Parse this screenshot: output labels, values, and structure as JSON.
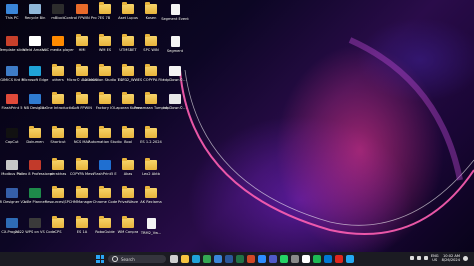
{
  "desktop": {
    "icons": [
      {
        "label": "This PC",
        "kind": "app",
        "color": "#3a86d9"
      },
      {
        "label": "Recycle Bin",
        "kind": "app",
        "color": "#8fb7d9"
      },
      {
        "label": "mBlock",
        "kind": "app",
        "color": "#2c2c2c"
      },
      {
        "label": "Control FPWIN Pro 7",
        "kind": "app",
        "color": "#e86a2a"
      },
      {
        "label": "ES 7B",
        "kind": "folder"
      },
      {
        "label": "Aset Lupus",
        "kind": "folder"
      },
      {
        "label": "Kosen",
        "kind": "folder"
      },
      {
        "label": "Segment Event",
        "kind": "file"
      },
      {
        "label": "Template slide",
        "kind": "app",
        "color": "#c7402b"
      },
      {
        "label": "Weld Amakei",
        "kind": "app",
        "color": "#ffffff"
      },
      {
        "label": "VLC media player",
        "kind": "app",
        "color": "#ff8a00"
      },
      {
        "label": "HMI",
        "kind": "folder"
      },
      {
        "label": "WM ES",
        "kind": "folder"
      },
      {
        "label": "UTMSBET",
        "kind": "folder"
      },
      {
        "label": "SPC WIN",
        "kind": "folder"
      },
      {
        "label": "Segment",
        "kind": "file"
      },
      {
        "label": "GIMICS Krd B",
        "kind": "app",
        "color": "#3e7cc7"
      },
      {
        "label": "Microsoft Edge",
        "kind": "app",
        "color": "#1fa3d8"
      },
      {
        "label": "others",
        "kind": "folder"
      },
      {
        "label": "Micro© A 2.2023",
        "kind": "folder"
      },
      {
        "label": "Automation Studio 7.0 ...",
        "kind": "folder"
      },
      {
        "label": "ESP32_WW",
        "kind": "folder"
      },
      {
        "label": "ES COPYPA File",
        "kind": "folder"
      },
      {
        "label": "tdpDown©...",
        "kind": "app",
        "color": "#f4f4f4"
      },
      {
        "label": "FlashPrint 5",
        "kind": "app",
        "color": "#e04a3a"
      },
      {
        "label": "NB Designer",
        "kind": "app",
        "color": "#2f7bd0"
      },
      {
        "label": "CX-One Introductio...",
        "kind": "folder"
      },
      {
        "label": "Soft FPWIN",
        "kind": "folder"
      },
      {
        "label": "Factory IO",
        "kind": "folder"
      },
      {
        "label": "Laporan Kuines",
        "kind": "folder"
      },
      {
        "label": "Penamaan Tumpak",
        "kind": "folder"
      },
      {
        "label": "tdpDown©...",
        "kind": "app",
        "color": "#e8e8e8"
      },
      {
        "label": "CapCut",
        "kind": "app",
        "color": "#111111"
      },
      {
        "label": "Dokumen",
        "kind": "folder"
      },
      {
        "label": "Shortcut",
        "kind": "folder"
      },
      {
        "label": "NCS MAP",
        "kind": "folder"
      },
      {
        "label": "Automation Studio",
        "kind": "folder"
      },
      {
        "label": "Bool",
        "kind": "folder"
      },
      {
        "label": "ES 1.2.2024",
        "kind": "folder"
      },
      {
        "label": "Modbus Poll",
        "kind": "app",
        "color": "#c7c7c7"
      },
      {
        "label": "Pixlex 8 Professional",
        "kind": "app",
        "color": "#c23a2a"
      },
      {
        "label": "perakhas",
        "kind": "folder"
      },
      {
        "label": "COPYPA Mess",
        "kind": "folder"
      },
      {
        "label": "FlashPrint5 E",
        "kind": "app",
        "color": "#1f6fd1"
      },
      {
        "label": "Akas",
        "kind": "folder"
      },
      {
        "label": "Lex2 Aktb",
        "kind": "folder"
      },
      {
        "label": "HMI Designer V2.7",
        "kind": "app",
        "color": "#355ea8"
      },
      {
        "label": "avie Planner",
        "kind": "app",
        "color": "#1e8a4a"
      },
      {
        "label": "Resources\\SPC",
        "kind": "folder"
      },
      {
        "label": "HMManager",
        "kind": "folder"
      },
      {
        "label": "Chrome Code",
        "kind": "folder"
      },
      {
        "label": "PrivatWave",
        "kind": "folder"
      },
      {
        "label": "AK Reclama",
        "kind": "folder"
      },
      {
        "label": "CX-Progra...",
        "kind": "app",
        "color": "#2e6cb5"
      },
      {
        "label": "2022 WPS on VS Code",
        "kind": "app",
        "color": "#3a3a3a"
      },
      {
        "label": "CPS",
        "kind": "folder"
      },
      {
        "label": "ES 1A",
        "kind": "folder"
      },
      {
        "label": "RoboGuide",
        "kind": "folder"
      },
      {
        "label": "WM Conpra",
        "kind": "folder"
      },
      {
        "label": "TRM2_Vw...",
        "kind": "file"
      }
    ]
  },
  "taskbar": {
    "search_placeholder": "Search",
    "apps": [
      {
        "name": "task-view",
        "color": "#cfcfcf"
      },
      {
        "name": "file-explorer",
        "color": "#f5c440"
      },
      {
        "name": "edge",
        "color": "#1fa3d8"
      },
      {
        "name": "chrome",
        "color": "#34a853"
      },
      {
        "name": "store",
        "color": "#3a86d9"
      },
      {
        "name": "word",
        "color": "#2b579a"
      },
      {
        "name": "excel",
        "color": "#217346"
      },
      {
        "name": "powerpoint",
        "color": "#d24726"
      },
      {
        "name": "zoom",
        "color": "#2d8cff"
      },
      {
        "name": "teams",
        "color": "#5059c9"
      },
      {
        "name": "whatsapp",
        "color": "#25d366"
      },
      {
        "name": "settings",
        "color": "#8a8a8a"
      },
      {
        "name": "capcut",
        "color": "#ffffff"
      },
      {
        "name": "spotify",
        "color": "#1db954"
      },
      {
        "name": "mail",
        "color": "#0078d4"
      },
      {
        "name": "acrobat",
        "color": "#e0261f"
      },
      {
        "name": "vs-code",
        "color": "#23a9f2"
      }
    ],
    "lang_top": "ENG",
    "lang_bottom": "US",
    "time": "10:02 AM",
    "date": "8/26/2024"
  }
}
